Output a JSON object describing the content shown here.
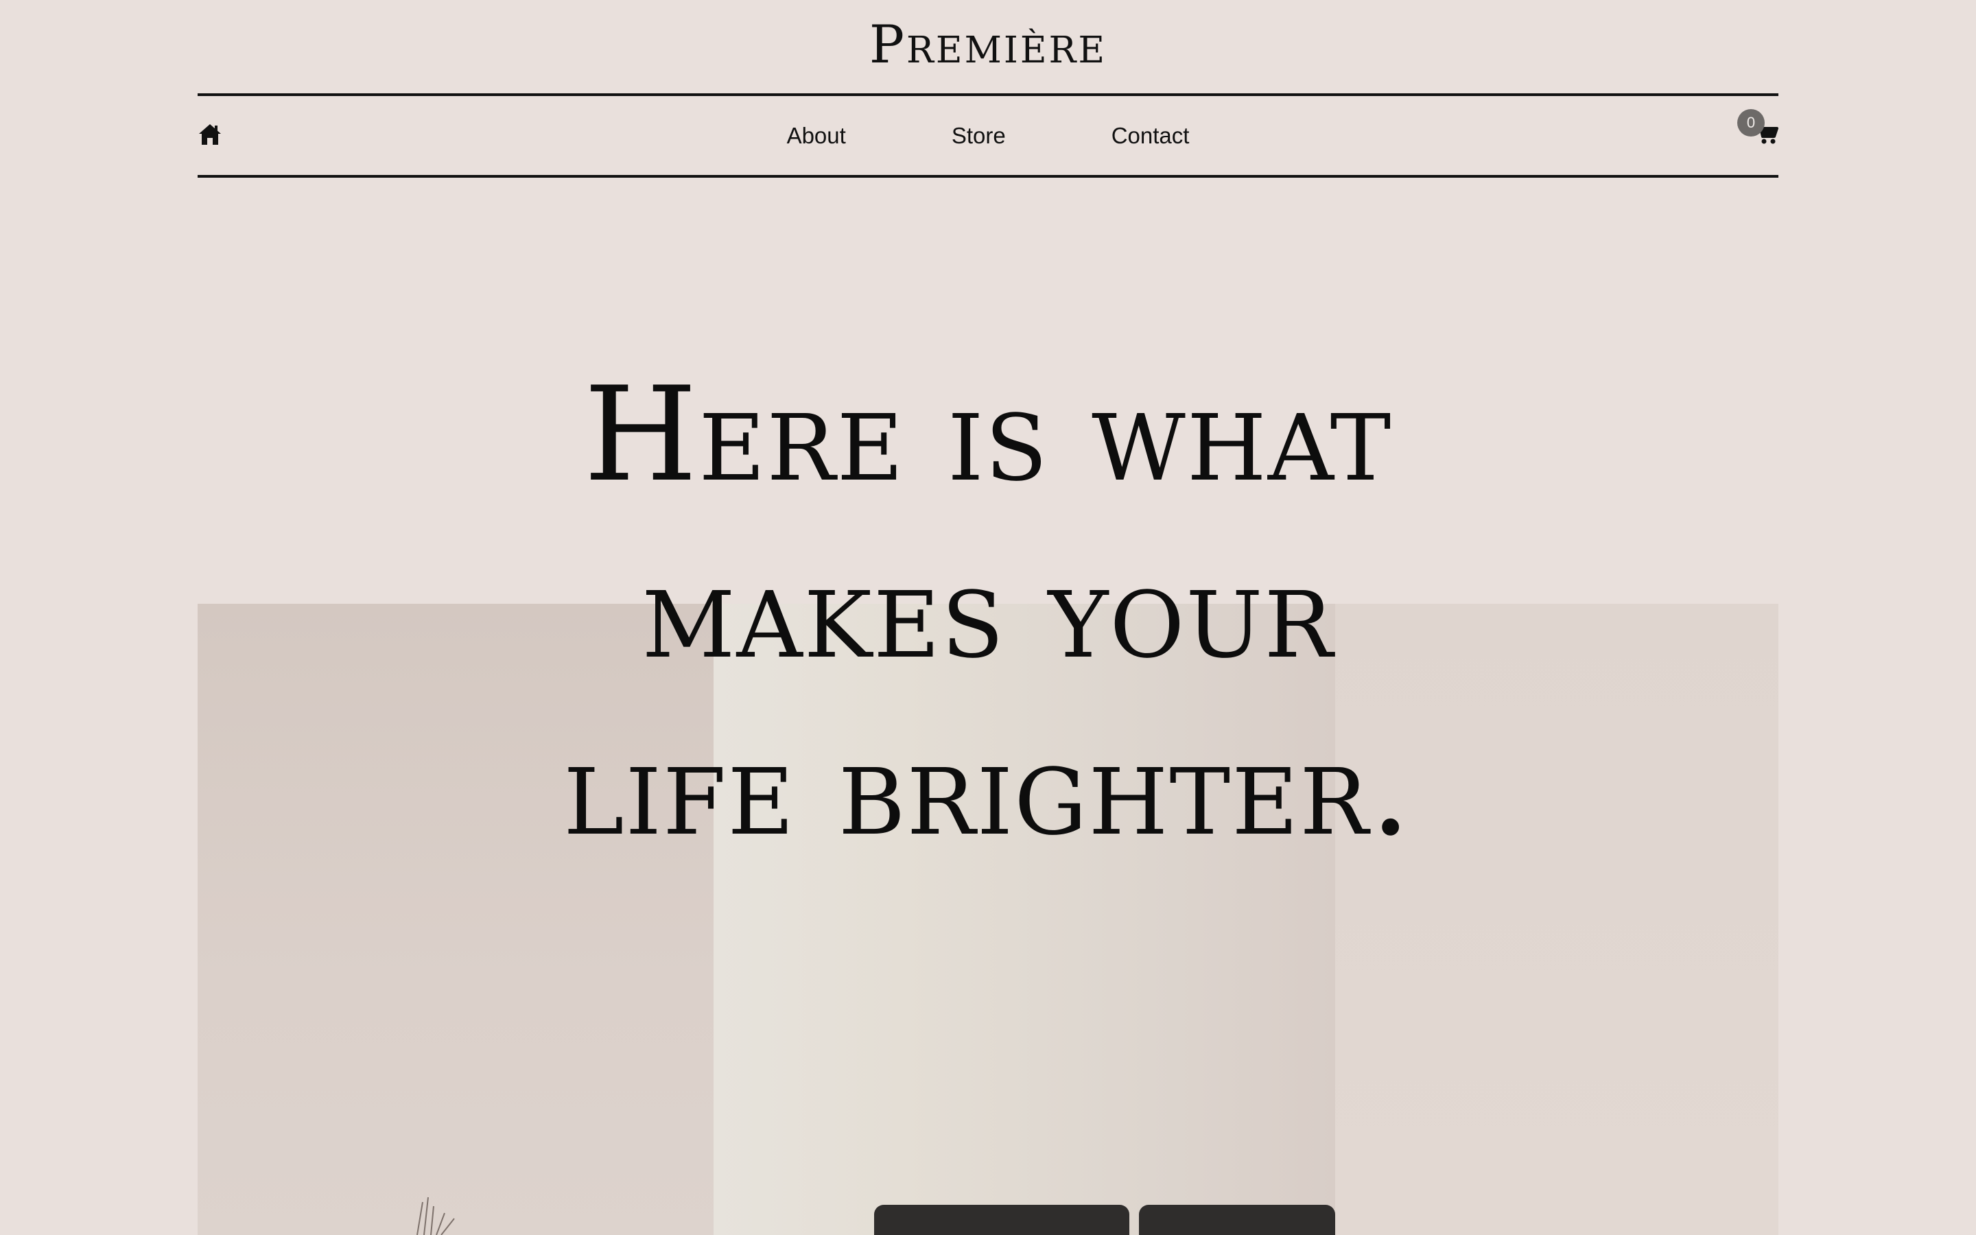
{
  "header": {
    "brand": "Première"
  },
  "nav": {
    "home_icon": "home-icon",
    "links": [
      "About",
      "Store",
      "Contact"
    ],
    "cart_icon": "cart-icon",
    "cart_count": "0"
  },
  "hero": {
    "headline_lines": [
      "Here is what",
      "makes your",
      "life brighter."
    ]
  },
  "colors": {
    "background": "#e9e0dc",
    "text": "#111111",
    "badge": "#6d6a68"
  }
}
